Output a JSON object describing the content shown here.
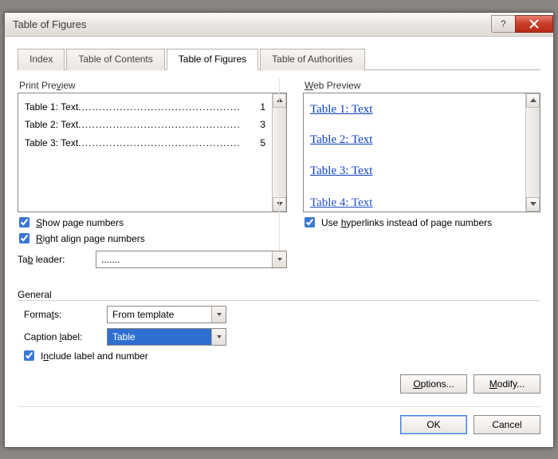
{
  "window": {
    "title": "Table of Figures"
  },
  "tabs": {
    "index": "Index",
    "toc": "Table of Contents",
    "tof": "Table of Figures",
    "toa": "Table of Authorities"
  },
  "print_preview": {
    "label": "Print Preview",
    "items": [
      {
        "text": "Table 1: Text",
        "page": "1"
      },
      {
        "text": "Table 2: Text",
        "page": "3"
      },
      {
        "text": "Table 3: Text",
        "page": "5"
      }
    ],
    "show_page_numbers_label_pre": "",
    "show_page_numbers_label": "Show page numbers",
    "right_align_label": "Right align page numbers",
    "tab_leader_label": "Tab leader:",
    "tab_leader_value": "......."
  },
  "web_preview": {
    "label": "Web Preview",
    "items": [
      {
        "text": "Table 1: Text"
      },
      {
        "text": "Table 2: Text"
      },
      {
        "text": "Table 3: Text"
      },
      {
        "text": "Table 4: Text"
      }
    ],
    "use_hyperlinks_label": "Use hyperlinks instead of page numbers"
  },
  "general": {
    "label": "General",
    "formats_label": "Formats:",
    "formats_value": "From template",
    "caption_label_label": "Caption label:",
    "caption_label_value": "Table",
    "include_label": "Include label and number"
  },
  "buttons": {
    "options": "Options...",
    "modify": "Modify...",
    "ok": "OK",
    "cancel": "Cancel"
  }
}
